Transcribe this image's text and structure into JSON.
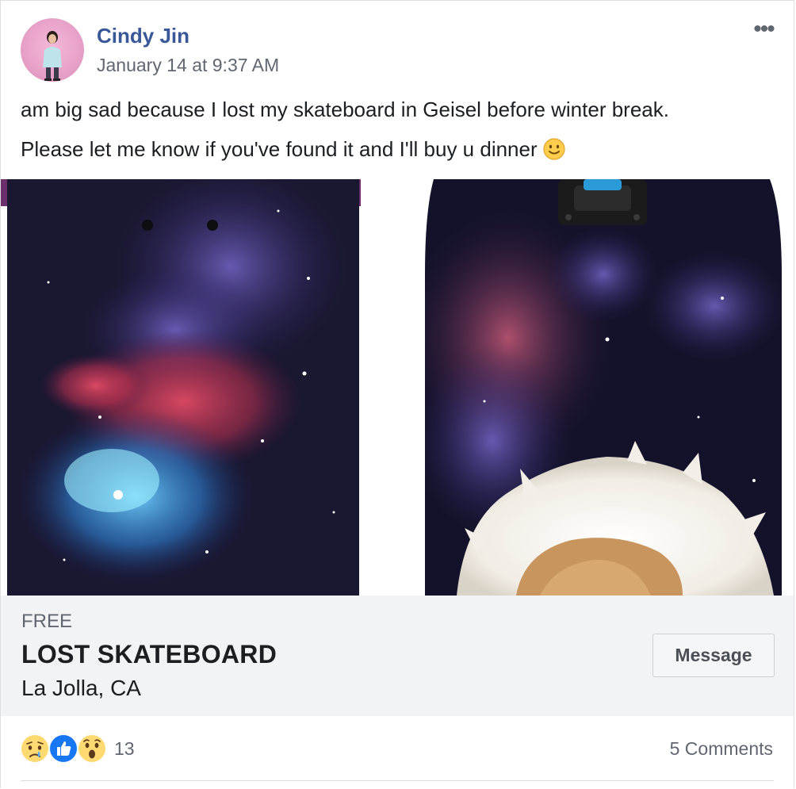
{
  "post": {
    "author": "Cindy Jin",
    "timestamp": "January 14 at 9:37 AM",
    "more_label": "•••",
    "text_line1": "am big sad because I lost my skateboard in Geisel before winter break.",
    "text_line2": "Please let me know if you've found it and I'll buy u dinner",
    "emoji": "slightly-smiling-face-icon"
  },
  "listing": {
    "price": "FREE",
    "title": "LOST SKATEBOARD",
    "location": "La Jolla, CA",
    "message_label": "Message"
  },
  "reactions": {
    "icons": [
      "sad-reaction-icon",
      "like-reaction-icon",
      "wow-reaction-icon"
    ],
    "count": "13",
    "comments": "5 Comments"
  },
  "colors": {
    "author_link": "#385898",
    "meta_gray": "#606770",
    "listing_bg": "#f2f3f5",
    "like_blue": "#1877f2"
  }
}
